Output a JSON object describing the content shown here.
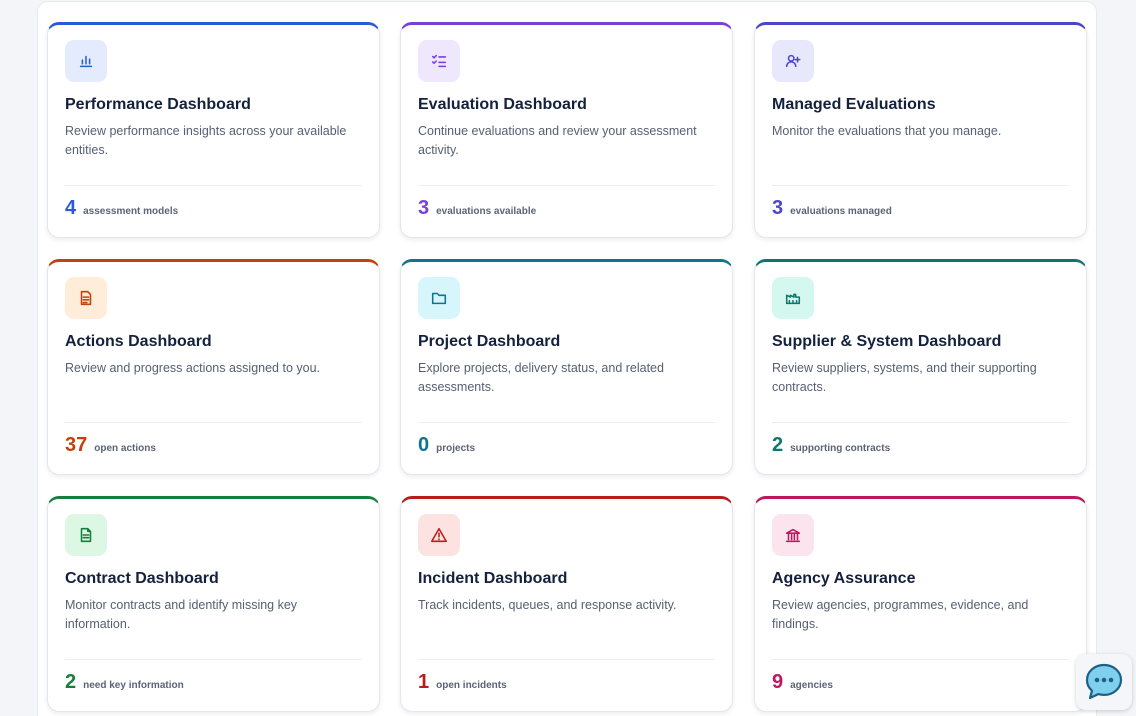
{
  "cards": [
    {
      "title": "Performance Dashboard",
      "description": "Review performance insights across your available entities.",
      "stat": "4",
      "stat_label": "assessment models",
      "accent": "#2a5bd7",
      "icon_bg": "#e3ebfc",
      "icon": "bar-chart-icon"
    },
    {
      "title": "Evaluation Dashboard",
      "description": "Continue evaluations and review your assessment activity.",
      "stat": "3",
      "stat_label": "evaluations available",
      "accent": "#7b3fd9",
      "icon_bg": "#efe7fc",
      "icon": "checklist-icon"
    },
    {
      "title": "Managed Evaluations",
      "description": "Monitor the evaluations that you manage.",
      "stat": "3",
      "stat_label": "evaluations managed",
      "accent": "#4a45c9",
      "icon_bg": "#e7e8fb",
      "icon": "user-plus-icon"
    },
    {
      "title": "Actions Dashboard",
      "description": "Review and progress actions assigned to you.",
      "stat": "37",
      "stat_label": "open actions",
      "accent": "#c2410c",
      "icon_bg": "#ffedd9",
      "icon": "document-icon"
    },
    {
      "title": "Project Dashboard",
      "description": "Explore projects, delivery status, and related assessments.",
      "stat": "0",
      "stat_label": "projects",
      "accent": "#0e7490",
      "icon_bg": "#d6f6fb",
      "icon": "folder-icon"
    },
    {
      "title": "Supplier & System Dashboard",
      "description": "Review suppliers, systems, and their supporting contracts.",
      "stat": "2",
      "stat_label": "supporting contracts",
      "accent": "#0f766e",
      "icon_bg": "#d4f7ef",
      "icon": "factory-icon"
    },
    {
      "title": "Contract Dashboard",
      "description": "Monitor contracts and identify missing key information.",
      "stat": "2",
      "stat_label": "need key information",
      "accent": "#15803d",
      "icon_bg": "#dcf7e3",
      "icon": "file-text-icon"
    },
    {
      "title": "Incident Dashboard",
      "description": "Track incidents, queues, and response activity.",
      "stat": "1",
      "stat_label": "open incidents",
      "accent": "#b91c1c",
      "icon_bg": "#fde2e2",
      "icon": "warning-icon"
    },
    {
      "title": "Agency Assurance",
      "description": "Review agencies, programmes, evidence, and findings.",
      "stat": "9",
      "stat_label": "agencies",
      "accent": "#be185d",
      "icon_bg": "#fce4ef",
      "icon": "bank-icon"
    }
  ],
  "chat_button": {
    "icon": "chat-icon",
    "color": "#3aa7d8"
  }
}
